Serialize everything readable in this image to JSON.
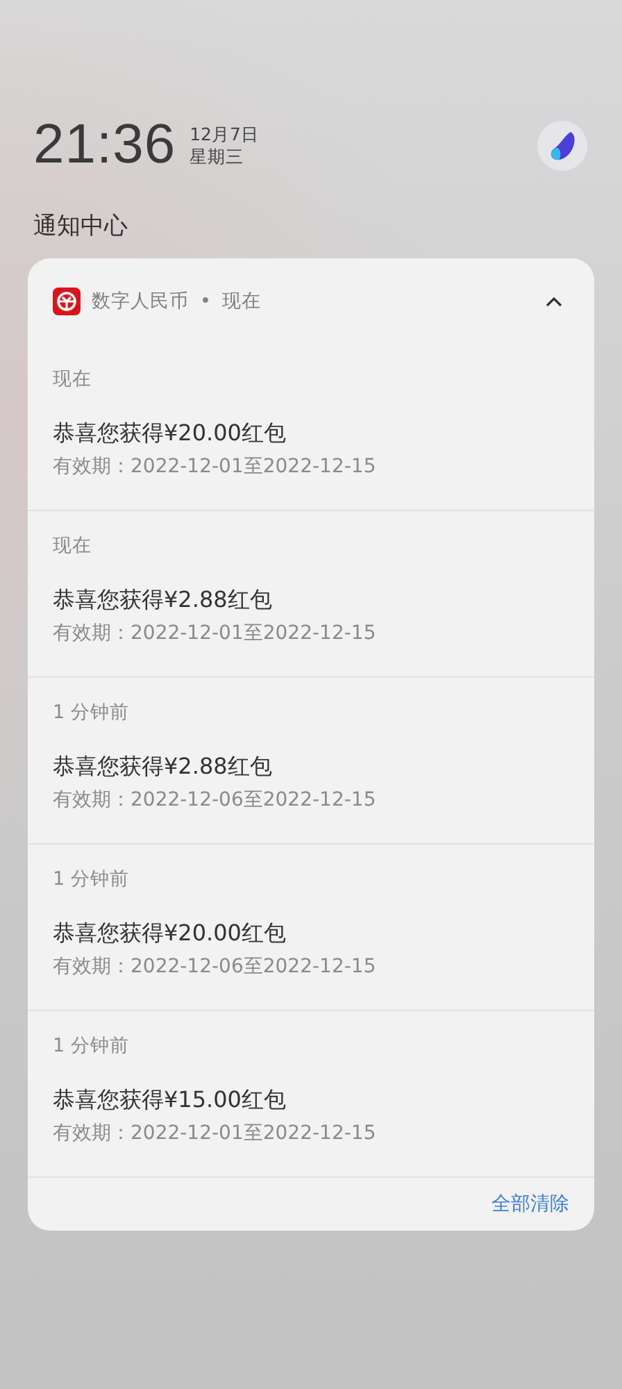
{
  "clock": {
    "time": "21:36",
    "date": "12月7日",
    "weekday": "星期三"
  },
  "title": "通知中心",
  "group": {
    "app": "数字人民币",
    "separator": "•",
    "time": "现在",
    "expanded": true,
    "items": [
      {
        "time": "现在",
        "title": "恭喜您获得¥20.00红包",
        "detail": "有效期：2022-12-01至2022-12-15"
      },
      {
        "time": "现在",
        "title": "恭喜您获得¥2.88红包",
        "detail": "有效期：2022-12-01至2022-12-15"
      },
      {
        "time": "1 分钟前",
        "title": "恭喜您获得¥2.88红包",
        "detail": "有效期：2022-12-06至2022-12-15"
      },
      {
        "time": "1 分钟前",
        "title": "恭喜您获得¥20.00红包",
        "detail": "有效期：2022-12-06至2022-12-15"
      },
      {
        "time": "1 分钟前",
        "title": "恭喜您获得¥15.00红包",
        "detail": "有效期：2022-12-01至2022-12-15"
      }
    ],
    "clear_all": "全部清除"
  }
}
